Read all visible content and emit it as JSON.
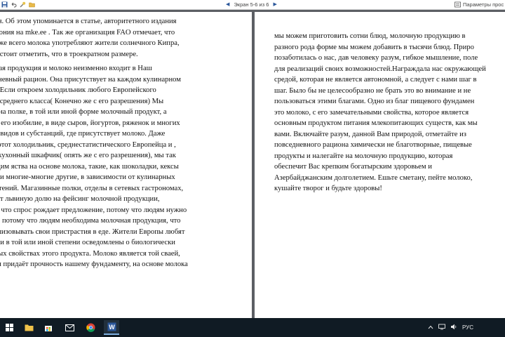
{
  "toolbar": {
    "screen_label": "Экран 5-6 из 6",
    "view_params_label": "Параметры прос"
  },
  "document": {
    "left_page": {
      "paragraphs": [
        [
          "збания. Об этом упоминается в статье, авторитетного издания",
          "К-Эстония на mke.ee . Так же организация FAO отмечает, что",
          "ньше же всего молока употребляют жители солнечного Кипра,",
          "ичём, стоит отметить, что в троекратном размере."
        ],
        [
          "олочная продукция и молоко неизменно входит в Наш",
          "овседневный рацион. Она присутствует на каждом кулинарном",
          "ючке. Если откроем холодильник любого Европейского",
          "ителя  среднего класса( Конечно же с его разрешения) Мы",
          "идим на полке, в той или иной форме молочный продукт, а",
          "стями его изобилие, в виде сыров, йогуртов,  ряженок и многих",
          "ругих видов и субстанций, где присутствует молоко. Даже",
          "крыв этот холодильник, среднестатистического Европейца и ,",
          "крыв кухонный шкафчик( опять же с его разрешения), мы так",
          "е увидим яства на основе молока, такие, как шоколадки, кексы",
          "ченья и многие-многие другие, в зависимости от кулинарных",
          "едпочтений. Магазинные полки, отделы в сетевых гастрономах,",
          "деляют львиную долю на фейсинг молочной продукции,",
          "отому что спрос рождает предложение, потому что людям нужно",
          "олоко, потому что людям необходима молочная продукция, что",
          "ы реализовывать свои пристрастия в еде. Жители Европы любят",
          "олоко и в той или иной степени осведомлены о биологически",
          "олезных свойствах этого продукта. Молоко является той сваей,",
          "оторая придаёт прочность нашему фундаменту, на основе молока"
        ]
      ]
    },
    "right_page": {
      "paragraphs": [
        [
          "мы можем приготовить сотни блюд, молочную продукцию в",
          "разного рода форме мы можем добавить  в тысячи блюд. Приро",
          "позаботилась о нас, дав человеку разум, гибкое мышление, поле",
          "для реализаций своих возможностей.Награждала нас окружающей",
          "средой, которая не является автономной, а следует с нами шаг в",
          "шаг. Было бы не целесообразно не брать это во внимание и не",
          "пользоваться  этими благами. Одно из благ пищевого фундамен",
          "это молоко, с его замечательными свойства, которое является",
          "основным продуктом питания млекопитающих существ, как мы",
          "вами. Включайте разум, данной Вам природой, отметайте из",
          "повседневного рациона  химически не благотворные, пищевые",
          "продукты и налегайте на молочную продукцию, которая",
          "обеспечит Вас крепким  богатырским здоровьем и",
          "Азербайджанским долголетием. Ешьте сметану, пейте молоко,",
          "кушайте творог и будьте здоровы!"
        ]
      ]
    }
  },
  "taskbar": {
    "language": "РУС"
  },
  "colors": {
    "toolbar_bg": "#ffffff",
    "doc_bg": "#5c5f64",
    "page_bg": "#ffffff",
    "taskbar_bg": "#101b24",
    "accent": "#2b579a"
  }
}
